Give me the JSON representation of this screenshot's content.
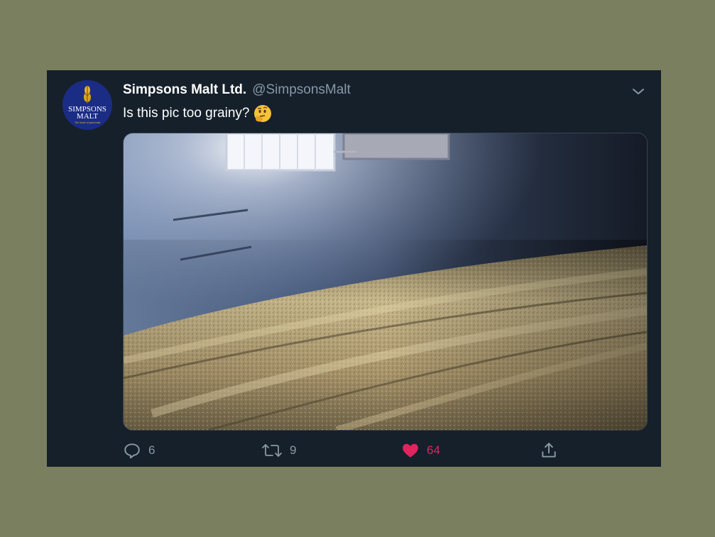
{
  "tweet": {
    "display_name": "Simpsons Malt Ltd.",
    "handle": "@SimpsonsMalt",
    "text": "Is this pic too grainy?",
    "emoji": "thinking-face-emoji",
    "avatar_logo": "SIMPSONS MALT",
    "avatar_tagline": "The home of good malt",
    "media_description": "photo",
    "actions": {
      "reply_count": "6",
      "retweet_count": "9",
      "like_count": "64",
      "liked": true
    }
  },
  "colors": {
    "page_bg": "#7a7f60",
    "tweet_bg": "#15202b",
    "text_primary": "#ffffff",
    "text_secondary": "#8899a6",
    "like_active": "#e0245e"
  }
}
